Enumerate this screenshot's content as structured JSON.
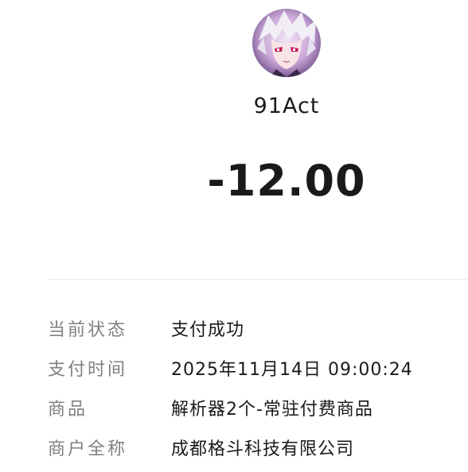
{
  "merchant": {
    "avatar_icon": "anime-character-avatar-icon",
    "name": "91Act"
  },
  "amount": "-12.00",
  "details": [
    {
      "label": "当前状态",
      "value": "支付成功"
    },
    {
      "label": "支付时间",
      "value": "2025年11月14日 09:00:24"
    },
    {
      "label": "商品",
      "value": "解析器2个-常驻付费商品"
    },
    {
      "label": "商户全称",
      "value": "成都格斗科技有限公司"
    }
  ],
  "colors": {
    "label": "#808080",
    "value": "#1a1a1a",
    "divider": "#ececec"
  }
}
